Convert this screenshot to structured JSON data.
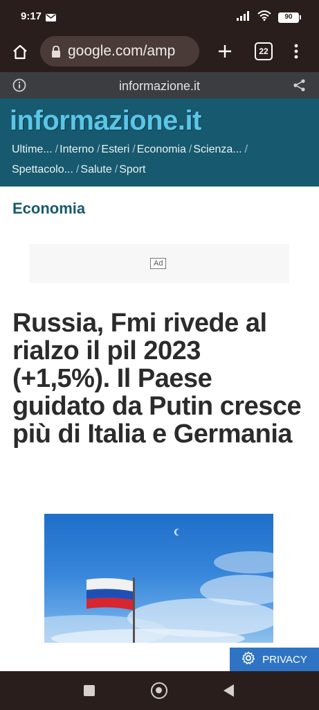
{
  "status_bar": {
    "time": "9:17",
    "battery": "90",
    "icons": [
      "mail-icon",
      "signal-icon",
      "wifi-icon",
      "battery-icon"
    ]
  },
  "browser": {
    "url": "google.com/amp",
    "tab_count": "22",
    "icons": [
      "home-icon",
      "lock-icon",
      "plus-icon",
      "tabs-icon",
      "more-vert-icon"
    ]
  },
  "amp_header": {
    "domain": "informazione.it",
    "icons": [
      "info-icon",
      "share-icon"
    ]
  },
  "site": {
    "logo": "informazione.it",
    "nav_row1": [
      {
        "label": "Ultime...",
        "sep": "/"
      },
      {
        "label": "Interno",
        "sep": "/"
      },
      {
        "label": "Esteri",
        "sep": "/"
      },
      {
        "label": "Economia",
        "sep": "/"
      },
      {
        "label": "Scienza...",
        "sep": "/"
      }
    ],
    "nav_row2": [
      {
        "label": "Spettacolo...",
        "sep": "/"
      },
      {
        "label": "Salute",
        "sep": "/"
      },
      {
        "label": "Sport",
        "sep": ""
      }
    ],
    "brand_color": "#17596e",
    "logo_color": "#5bc6e8"
  },
  "article": {
    "section": "Economia",
    "ad_label": "Ad",
    "headline": "Russia, Fmi rivede al rialzo il pil 2023 (+1,5%). Il Paese guidato da Putin cresce più di Italia e Germania",
    "image_icon": "russian-flag-sky-photo"
  },
  "privacy": {
    "label": "PRIVACY",
    "icon": "gear-icon"
  },
  "android_nav": {
    "icons": [
      "recents-square-icon",
      "home-circle-icon",
      "back-triangle-icon"
    ]
  }
}
